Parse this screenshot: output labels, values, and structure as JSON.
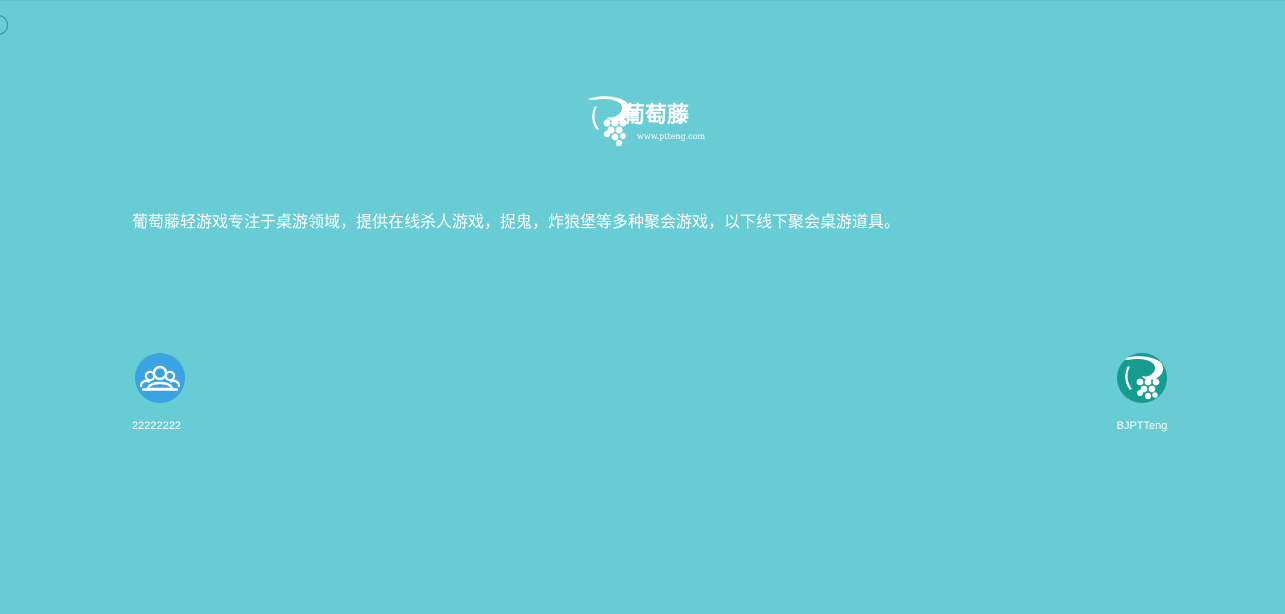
{
  "brand": {
    "name": "葡萄藤",
    "url": "www.ptteng.com",
    "logo_icon": "grape-vine-logo-icon"
  },
  "intro": {
    "text": "葡萄藤轻游戏专注于桌游领域，提供在线杀人游戏，捉鬼，炸狼堡等多种聚会游戏，以下线下聚会桌游道具。"
  },
  "contacts": [
    {
      "icon": "group-users-icon",
      "label": "22222222"
    },
    {
      "icon": "grape-vine-logo-icon",
      "label": "BJPTTeng"
    }
  ],
  "colors": {
    "background": "#68ccd5",
    "group_avatar": "#3aa3e3",
    "brand_avatar": "#159c91",
    "text": "#ffffff"
  }
}
